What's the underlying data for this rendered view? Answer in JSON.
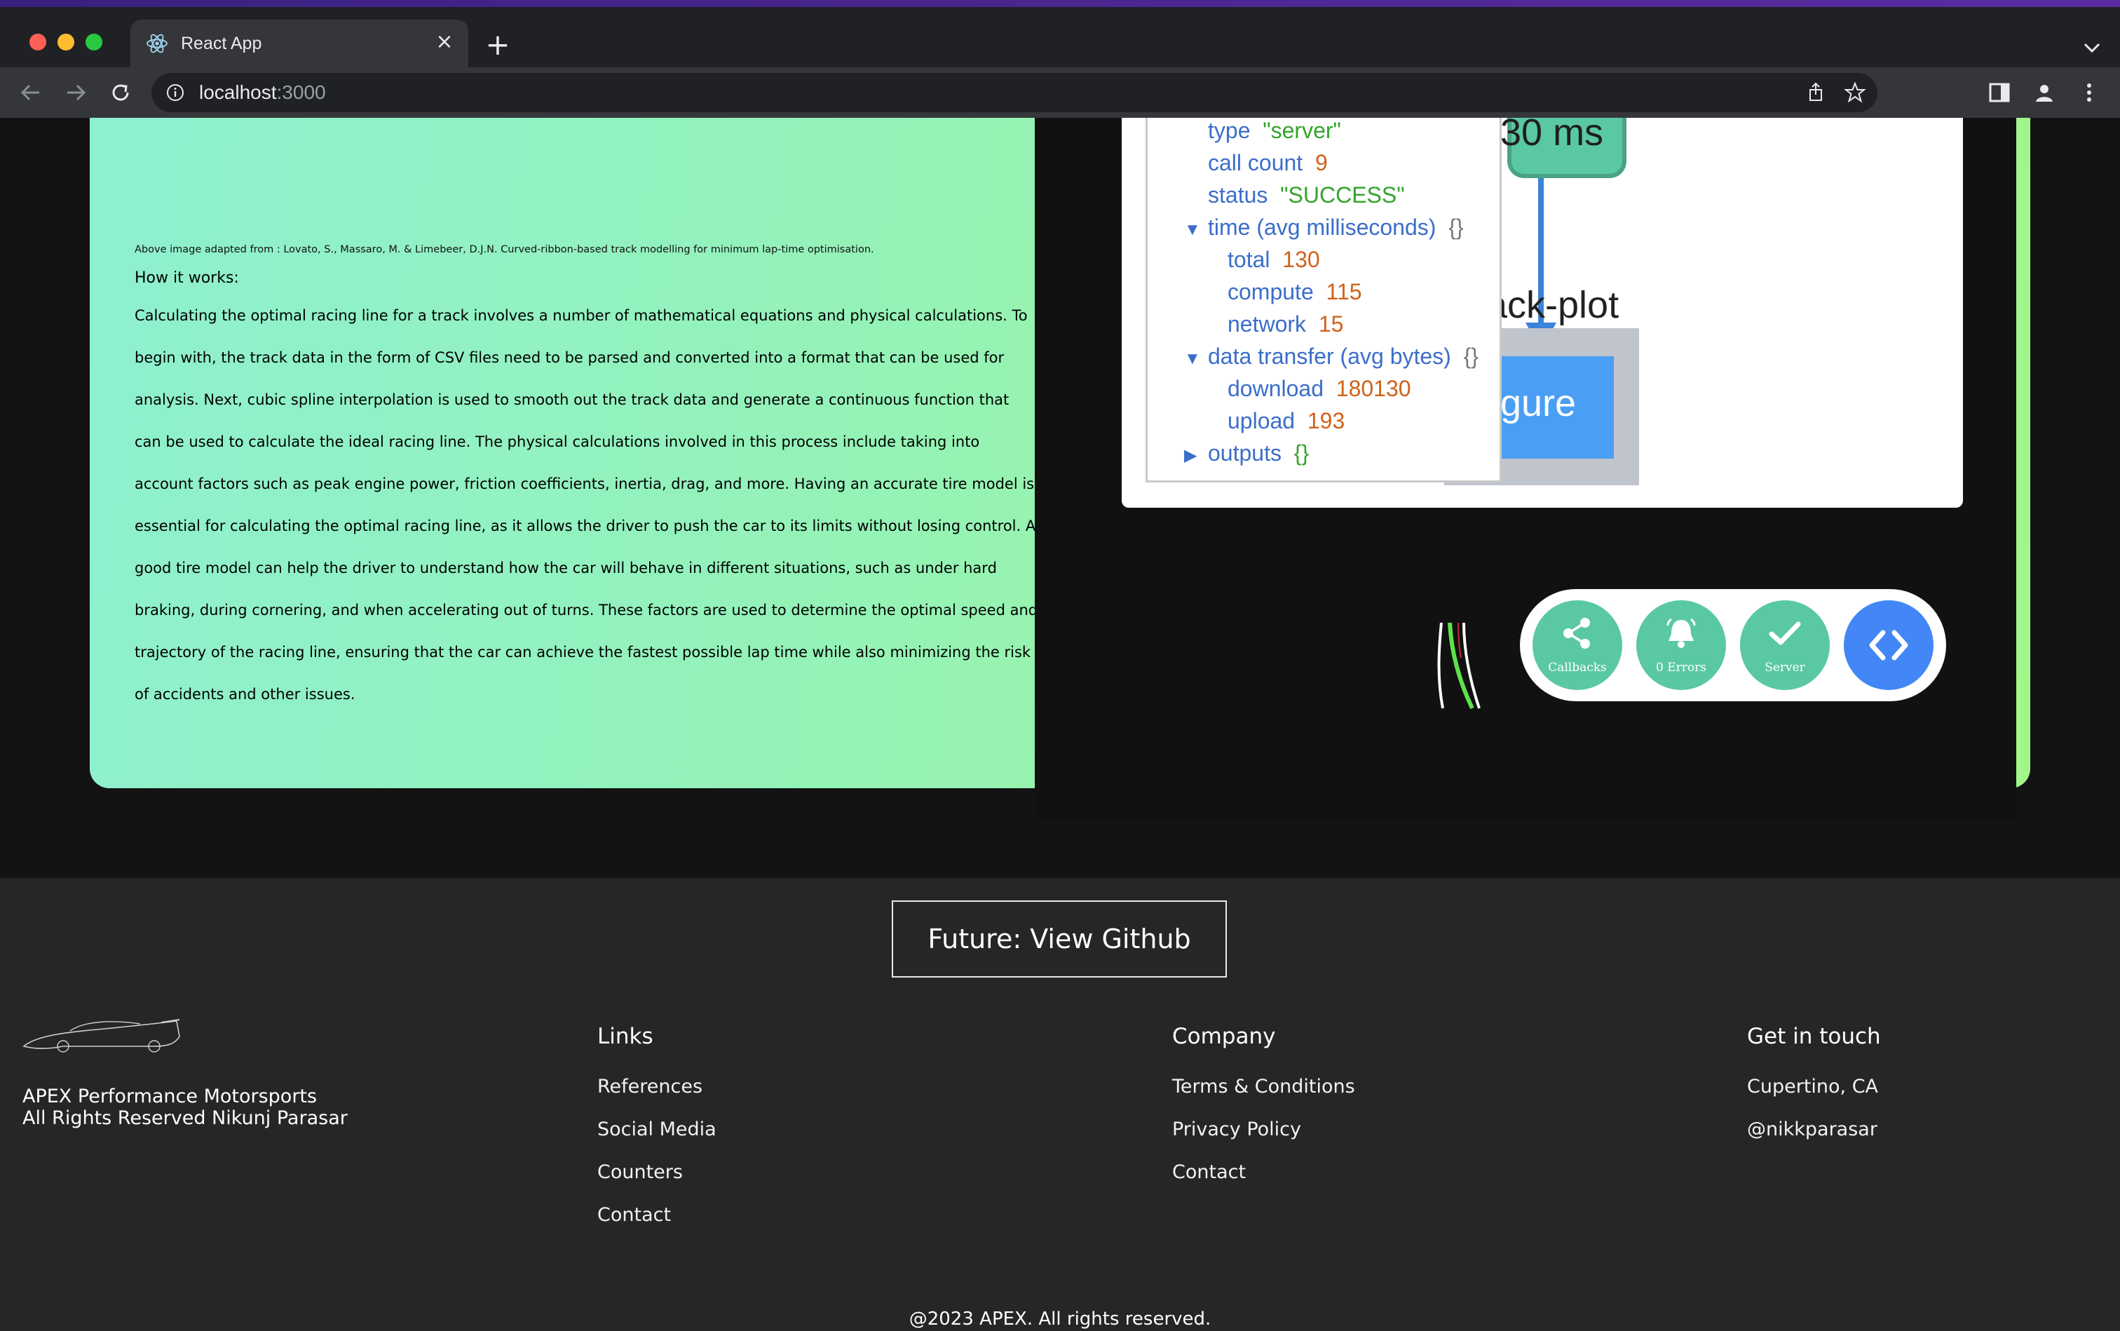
{
  "browser": {
    "tab_title": "React App",
    "url_host": "localhost",
    "url_port": ":3000",
    "new_tab_symbol": "+",
    "close_symbol": "×"
  },
  "article": {
    "caption": "Above image adapted from : Lovato, S., Massaro, M. & Limebeer, D.J.N. Curved-ribbon-based track modelling for minimum lap-time optimisation.",
    "heading": "How it works:",
    "body": "Calculating the optimal racing line for a track involves a number of mathematical equations and physical calculations. To begin with, the track data in the form of CSV files need to be parsed and converted into a format that can be used for analysis. Next, cubic spline interpolation is used to smooth out the track data and generate a continuous function that can be used to calculate the ideal racing line. The physical calculations involved in this process include taking into account factors such as peak engine power, friction coefficients, inertia, drag, and more. Having an accurate tire model is essential for calculating the optimal racing line, as it allows the driver to push the car to its limits without losing control. A good tire model can help the driver to understand how the car will behave in different situations, such as under hard braking, during cornering, and when accelerating out of turns. These factors are used to determine the optimal speed and trajectory of the racing line, ensuring that the car can achieve the fastest possible lap time while also minimizing the risk of accidents and other issues."
  },
  "callback_graph": {
    "node_time": "30 ms",
    "plot_label": "ack-plot",
    "figure_label": "igure"
  },
  "callback_tree": {
    "rows": [
      {
        "key": "type",
        "value": "\"server\"",
        "kind": "string"
      },
      {
        "key": "call count",
        "value": "9",
        "kind": "number"
      },
      {
        "key": "status",
        "value": "\"SUCCESS\"",
        "kind": "string"
      },
      {
        "key": "time (avg milliseconds)",
        "value": "{}",
        "kind": "group"
      },
      {
        "key": "total",
        "value": "130",
        "kind": "number"
      },
      {
        "key": "compute",
        "value": "115",
        "kind": "number"
      },
      {
        "key": "network",
        "value": "15",
        "kind": "number"
      },
      {
        "key": "data transfer (avg bytes)",
        "value": "{}",
        "kind": "group"
      },
      {
        "key": "download",
        "value": "180130",
        "kind": "number"
      },
      {
        "key": "upload",
        "value": "193",
        "kind": "number"
      },
      {
        "key": "outputs",
        "value": "{}",
        "kind": "collapsed"
      }
    ]
  },
  "devtools": {
    "callbacks_label": "Callbacks",
    "errors_label": "0 Errors",
    "server_label": "Server",
    "colors": {
      "green": "#5ac8a4",
      "blue": "#4287f5"
    }
  },
  "footer": {
    "github_button": "Future: View Github",
    "brand_line1": "APEX Performance Motorsports",
    "brand_line2": "All Rights Reserved Nikunj Parasar",
    "links": {
      "title": "Links",
      "items": [
        "References",
        "Social Media",
        "Counters",
        "Contact"
      ]
    },
    "company": {
      "title": "Company",
      "items": [
        "Terms & Conditions",
        "Privacy Policy",
        "Contact"
      ]
    },
    "contact": {
      "title": "Get in touch",
      "items": [
        "Cupertino, CA",
        "@nikkparasar"
      ]
    },
    "copyright": "@2023 APEX. All rights reserved."
  }
}
